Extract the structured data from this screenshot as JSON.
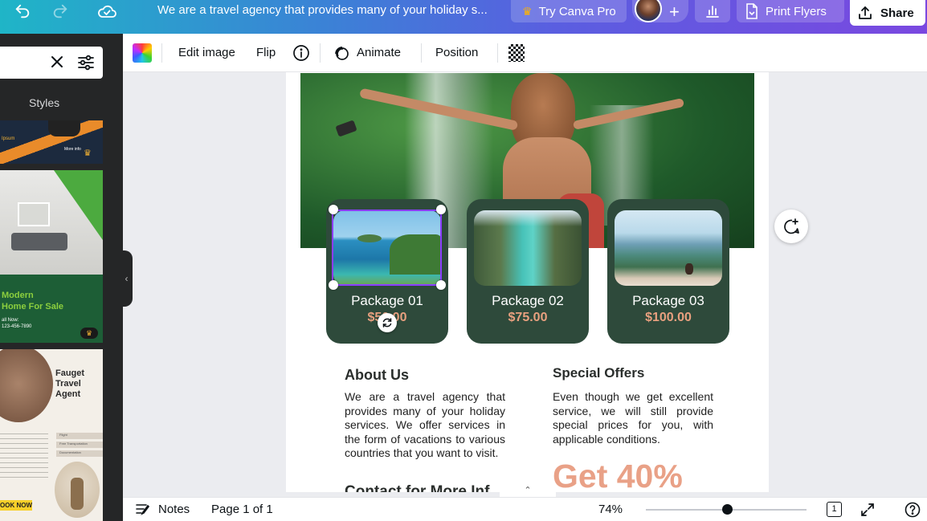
{
  "topbar": {
    "doc_title": "We are a travel agency that provides many of your holiday s...",
    "try_pro_label": "Try Canva Pro",
    "print_label": "Print Flyers",
    "share_label": "Share",
    "icons": [
      "undo-icon",
      "redo-icon",
      "cloud-saved-icon",
      "crown-icon",
      "add-icon",
      "stats-icon",
      "print-icon",
      "share-upload-icon"
    ]
  },
  "sidebar": {
    "search_value": "",
    "styles_label": "Styles",
    "templates": [
      {
        "lines": [
          "Ipsum"
        ],
        "badge": "More info"
      },
      {
        "lines": [
          "Modern",
          "Home For Sale",
          "all Now:",
          "123-456-7890"
        ]
      },
      {
        "lines": [
          "Fauget",
          "Travel",
          "Agent",
          "Flight",
          "Free Transportation",
          "Documentation",
          "OOK NOW"
        ]
      }
    ]
  },
  "toolbar": {
    "edit_image": "Edit image",
    "flip": "Flip",
    "animate": "Animate",
    "position": "Position"
  },
  "design": {
    "packages": [
      {
        "name": "Package 01",
        "price": "$50.00"
      },
      {
        "name": "Package 02",
        "price": "$75.00"
      },
      {
        "name": "Package 03",
        "price": "$100.00"
      }
    ],
    "about_heading": "About Us",
    "about_text": "We are a travel agency that provides many of your holiday services. We offer services in the form of vacations to various countries that you want to visit.",
    "offers_heading": "Special Offers",
    "offers_text": "Even though we get excellent service, we will still provide special prices for you, with applicable conditions.",
    "promo": "Get 40%",
    "contact_partial": "Contact for More Inf"
  },
  "bottombar": {
    "notes_label": "Notes",
    "page_label": "Page 1 of 1",
    "zoom": "74%",
    "zoom_fraction": 0.74,
    "page_count_icon": "1"
  },
  "colors": {
    "card_green": "#2e4a3b",
    "price_salmon": "#e8a07f",
    "selection_purple": "#8b3dff",
    "sidebar_bg": "#252627"
  }
}
